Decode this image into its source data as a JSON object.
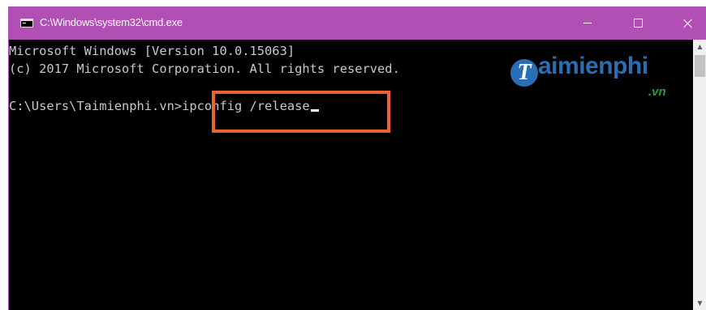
{
  "window": {
    "title": "C:\\Windows\\system32\\cmd.exe",
    "titlebar_color": "#b24fb5",
    "controls": {
      "minimize_icon": "minimize-icon",
      "maximize_icon": "maximize-icon",
      "close_icon": "close-icon"
    }
  },
  "console": {
    "background": "#000000",
    "text_color": "#c8c8c8",
    "lines": [
      "Microsoft Windows [Version 10.0.15063]",
      "(c) 2017 Microsoft Corporation. All rights reserved."
    ],
    "prompt": "C:\\Users\\Taimienphi.vn>",
    "command": "ipconfig /release",
    "highlight_color": "#ef6230"
  },
  "watermark": {
    "logo_letter": "T",
    "word": "aimienphi",
    "tld": ".vn"
  },
  "scrollbar": {
    "up_arrow": "▲",
    "down_arrow": "▼"
  }
}
